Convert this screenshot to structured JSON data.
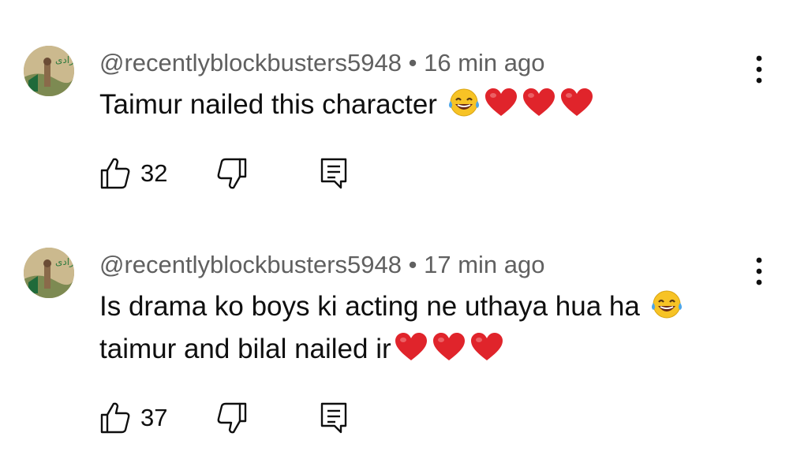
{
  "comments": [
    {
      "author": "@recentlyblockbusters5948",
      "separator": " • ",
      "time": "16 min ago",
      "text": "Taimur nailed this character ",
      "emojis": [
        "laughing-crying",
        "red-heart",
        "red-heart",
        "red-heart"
      ],
      "likes": "32",
      "avatar_text": "آزادی"
    },
    {
      "author": "@recentlyblockbusters5948",
      "separator": " • ",
      "time": "17 min ago",
      "text_line1": "Is drama ko boys ki acting ne uthaya hua ha ",
      "text_line2": "taimur and bilal nailed ir",
      "emojis_line1": [
        "laughing-crying"
      ],
      "emojis_line2": [
        "red-heart",
        "red-heart",
        "red-heart"
      ],
      "likes": "37",
      "avatar_text": "آزادی"
    }
  ],
  "icons": {
    "like": "thumb-up-outline-icon",
    "dislike": "thumb-down-outline-icon",
    "reply": "reply-comment-icon",
    "more": "three-dot-vertical-icon"
  },
  "colors": {
    "meta_text": "#606060",
    "body_text": "#0f0f0f",
    "heart": "#e0242b",
    "emoji_face": "#f7c325"
  }
}
